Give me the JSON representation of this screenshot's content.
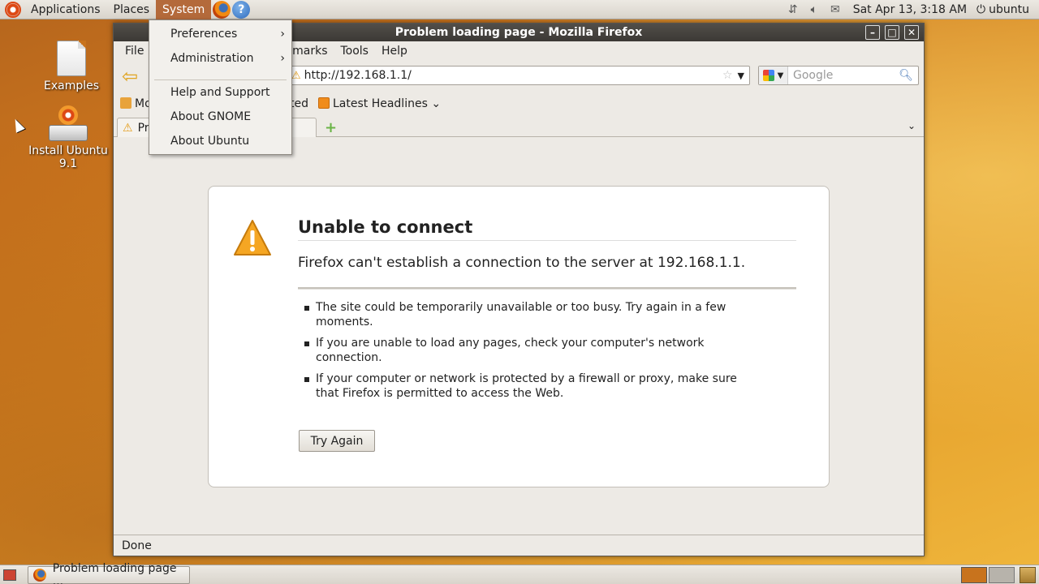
{
  "top_panel": {
    "menus": [
      "Applications",
      "Places",
      "System"
    ],
    "clock": "Sat Apr 13,  3:18 AM",
    "user": "ubuntu"
  },
  "desktop": {
    "icons": [
      {
        "label": "Examples"
      },
      {
        "label": "Install Ubuntu 9.1"
      }
    ]
  },
  "system_menu": {
    "items": [
      {
        "label": "Preferences",
        "submenu": true
      },
      {
        "label": "Administration",
        "submenu": true
      },
      {
        "label": "Help and Support",
        "submenu": false
      },
      {
        "label": "About GNOME",
        "submenu": false
      },
      {
        "label": "About Ubuntu",
        "submenu": false
      }
    ]
  },
  "window": {
    "title": "Problem loading page - Mozilla Firefox",
    "menubar": [
      "File",
      "okmarks",
      "Tools",
      "Help"
    ],
    "url": "http://192.168.1.1/",
    "search_placeholder": "Google",
    "bookmarks": [
      "Mo",
      "arted",
      "Latest Headlines"
    ],
    "tab_title": "Pro",
    "status": "Done"
  },
  "error_page": {
    "title": "Unable to connect",
    "message": "Firefox can't establish a connection to the server at 192.168.1.1.",
    "bullets": [
      "The site could be temporarily unavailable or too busy. Try again in a few moments.",
      "If you are unable to load any pages, check your computer's network connection.",
      "If your computer or network is protected by a firewall or proxy, make sure that Firefox is permitted to access the Web."
    ],
    "try_again": "Try Again"
  },
  "bottom_panel": {
    "task_label": "Problem loading page ..."
  },
  "colors": {
    "panel_active": "#b46a3b",
    "warning": "#e39b16",
    "ubuntu_orange": "#dd4814"
  }
}
